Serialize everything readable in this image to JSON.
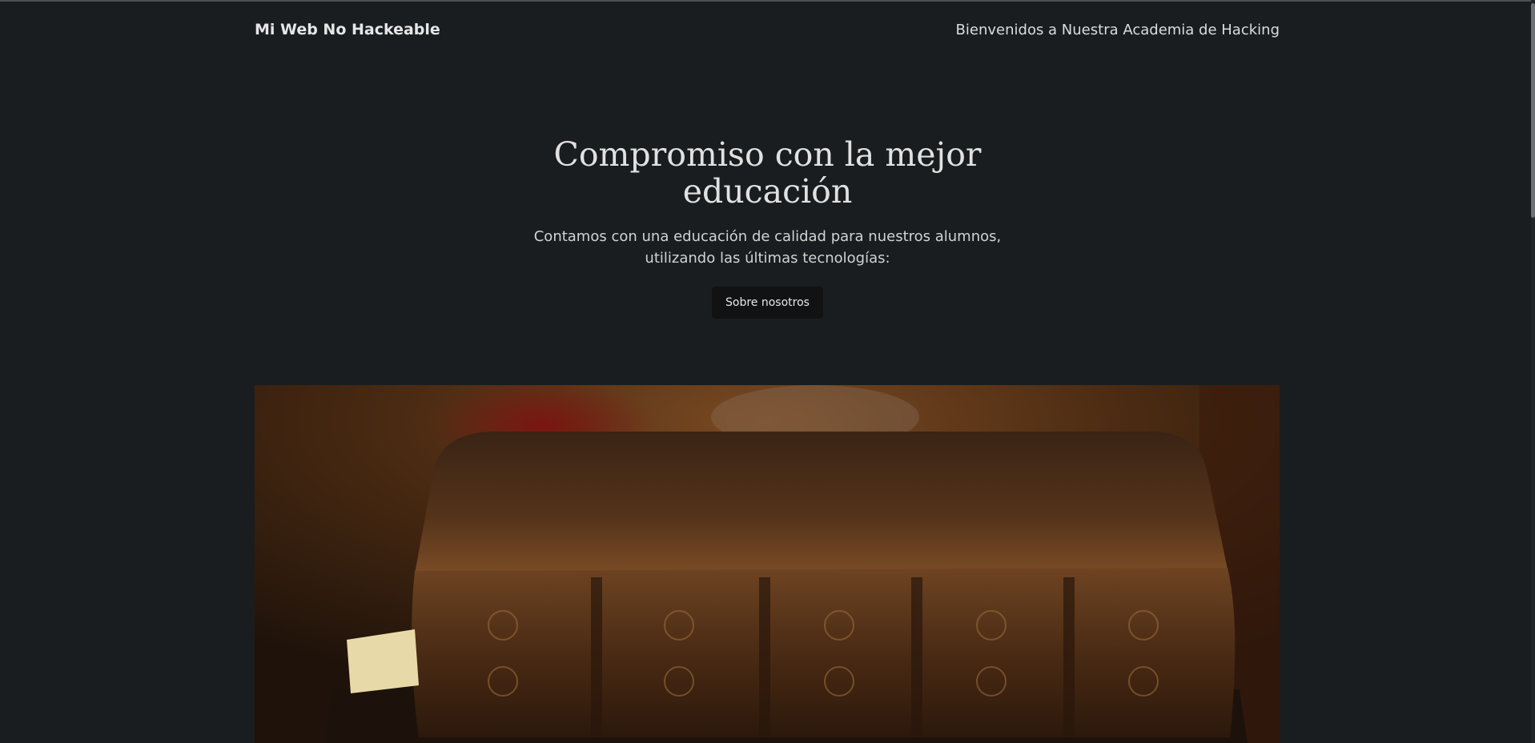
{
  "header": {
    "brand": "Mi Web No Hackeable",
    "nav_link": "Bienvenidos a Nuestra Academia de Hacking"
  },
  "hero": {
    "title": "Compromiso con la mejor educación",
    "description": "Contamos con una educación de calidad para nuestros alumnos, utilizando las últimas tecnologías:",
    "button_label": "Sobre nosotros"
  },
  "colors": {
    "background": "#1a1d1f",
    "button": "#101213",
    "text": "#dcdcdc"
  },
  "icons": {
    "photo": "old-leather-book-photo"
  }
}
